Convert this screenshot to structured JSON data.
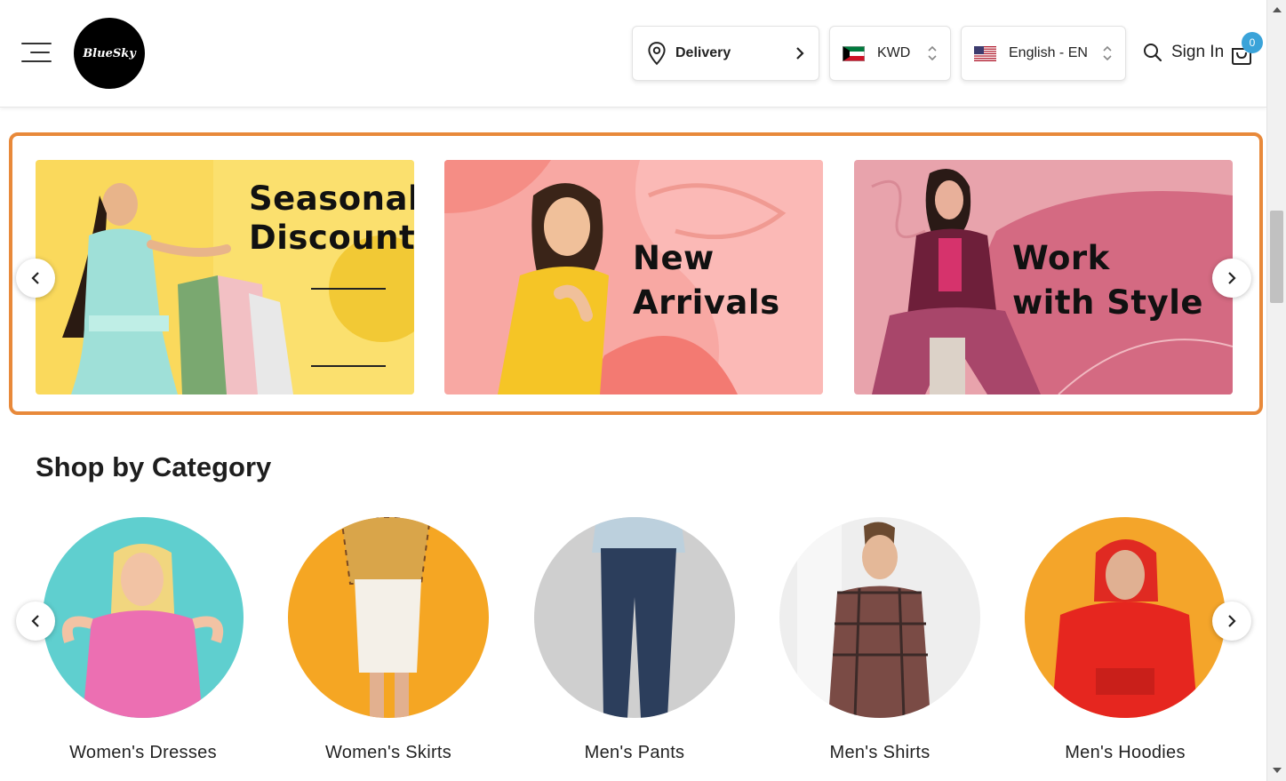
{
  "header": {
    "logo_text": "BlueSky",
    "delivery_label": "Delivery",
    "currency_label": "KWD",
    "language_label": "English - EN",
    "signin_label": "Sign In",
    "cart_count": "0"
  },
  "banners": [
    {
      "title_line1": "Seasonal",
      "title_line2": "Discount",
      "bg": "#fad95c"
    },
    {
      "title_line1": "New",
      "title_line2": "Arrivals",
      "bg": "#f8a8a3"
    },
    {
      "title_line1": "Work",
      "title_line2": "with Style",
      "bg": "#e8a3ac"
    }
  ],
  "categories_section": {
    "title": "Shop by Category",
    "items": [
      {
        "label": "Women's Dresses",
        "bg": "#5fcfcf"
      },
      {
        "label": "Women's Skirts",
        "bg": "#f5a623"
      },
      {
        "label": "Men's Pants",
        "bg": "#cfcfcf"
      },
      {
        "label": "Men's Shirts",
        "bg": "#eeeeee"
      },
      {
        "label": "Men's Hoodies",
        "bg": "#f4a52a"
      }
    ]
  },
  "colors": {
    "accent_frame": "#e8893a",
    "cart_badge": "#3aa3d9"
  },
  "icons": [
    "menu-icon",
    "location-pin-icon",
    "chevron-right-icon",
    "kuwait-flag-icon",
    "us-flag-icon",
    "up-down-icon",
    "search-icon",
    "cart-icon",
    "chevron-left-icon"
  ]
}
